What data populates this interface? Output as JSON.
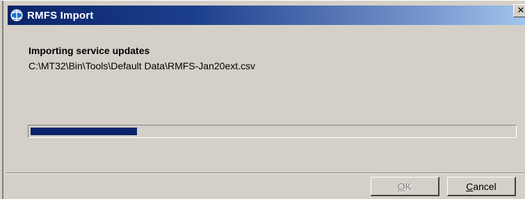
{
  "window": {
    "title": "RMFS Import",
    "close_glyph": "✕",
    "icon": "app-globe-icon"
  },
  "content": {
    "heading": "Importing service updates",
    "file_path": "C:\\MT32\\Bin\\Tools\\Default Data\\RMFS-Jan20ext.csv"
  },
  "progress": {
    "fraction": 0.22
  },
  "buttons": {
    "ok_label": "OK",
    "ok_enabled": false,
    "cancel_label": "Cancel"
  },
  "colors": {
    "titlebar_start": "#0a246a",
    "titlebar_end": "#a6caf0",
    "progress_fill": "#0a246a",
    "face": "#d4d0c8"
  }
}
